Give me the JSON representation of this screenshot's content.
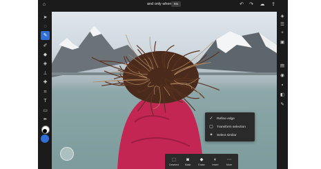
{
  "header": {
    "document_title": "and only when",
    "document_badge": "Mo"
  },
  "top_icons": [
    "undo-icon",
    "redo-icon",
    "cloud-icon",
    "share-icon"
  ],
  "left_tools": [
    "select-arrow-icon",
    "lasso-icon",
    "quick-select-icon",
    "brush-icon",
    "eraser-icon",
    "fill-icon",
    "clone-stamp-icon",
    "heal-icon",
    "crop-icon",
    "type-icon",
    "place-image-icon",
    "eyedropper-icon",
    "color-swatch-icon"
  ],
  "right_icons": [
    "layers-icon",
    "stack-icon",
    "add-layer-icon",
    "mask-icon",
    "adjustments-icon",
    "visibility-icon",
    "fx-icon",
    "properties-icon",
    "more-icon"
  ],
  "context_menu": {
    "items": [
      {
        "label": "Refine edge",
        "icon": "checkmark-icon"
      },
      {
        "label": "Transform selection",
        "icon": "transform-icon"
      },
      {
        "label": "Select similar",
        "icon": "magic-wand-icon"
      }
    ]
  },
  "action_bar": {
    "items": [
      {
        "label": "Deselect",
        "icon": "deselect-icon"
      },
      {
        "label": "Mask",
        "icon": "mask-icon"
      },
      {
        "label": "Erase",
        "icon": "eraser-icon"
      },
      {
        "label": "Invert",
        "icon": "invert-icon"
      },
      {
        "label": "More",
        "icon": "more-icon"
      }
    ]
  },
  "colors": {
    "ui_dark": "#1b1b1b",
    "panel": "#2a2a2a",
    "accent": "#2f6fd6",
    "jacket": "#c42654"
  }
}
